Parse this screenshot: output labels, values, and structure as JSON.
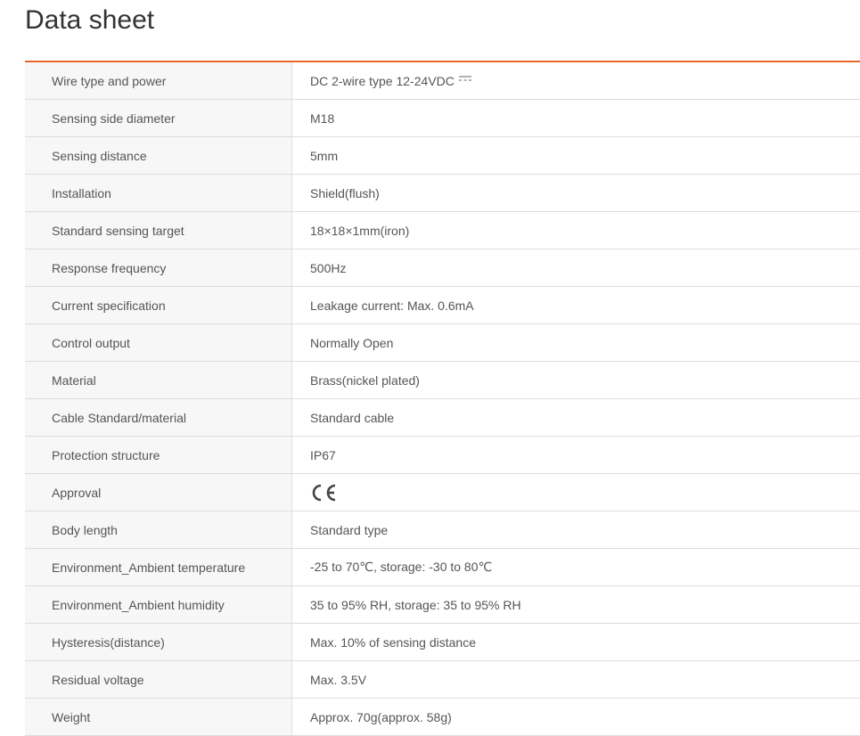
{
  "page": {
    "title": "Data sheet"
  },
  "accent_color": "#e8692a",
  "specs": [
    {
      "label": "Wire type and power",
      "value": "DC 2-wire type 12-24VDC",
      "icon": "dc-symbol-icon"
    },
    {
      "label": "Sensing side diameter",
      "value": "M18"
    },
    {
      "label": "Sensing distance",
      "value": "5mm"
    },
    {
      "label": "Installation",
      "value": "Shield(flush)"
    },
    {
      "label": "Standard sensing target",
      "value": "18×18×1mm(iron)"
    },
    {
      "label": "Response frequency",
      "value": "500Hz"
    },
    {
      "label": "Current specification",
      "value": "Leakage current: Max. 0.6mA"
    },
    {
      "label": "Control output",
      "value": "Normally Open"
    },
    {
      "label": "Material",
      "value": "Brass(nickel plated)"
    },
    {
      "label": "Cable Standard/material",
      "value": "Standard cable"
    },
    {
      "label": "Protection structure",
      "value": "IP67"
    },
    {
      "label": "Approval",
      "value": "CE",
      "icon": "ce-mark-icon"
    },
    {
      "label": "Body length",
      "value": "Standard type"
    },
    {
      "label": "Environment_Ambient temperature",
      "value": "-25 to 70℃, storage: -30 to 80℃"
    },
    {
      "label": "Environment_Ambient humidity",
      "value": "35 to 95% RH, storage: 35 to 95% RH"
    },
    {
      "label": "Hysteresis(distance)",
      "value": "Max. 10% of sensing distance"
    },
    {
      "label": "Residual voltage",
      "value": "Max. 3.5V"
    },
    {
      "label": "Weight",
      "value": "Approx. 70g(approx. 58g)"
    }
  ]
}
